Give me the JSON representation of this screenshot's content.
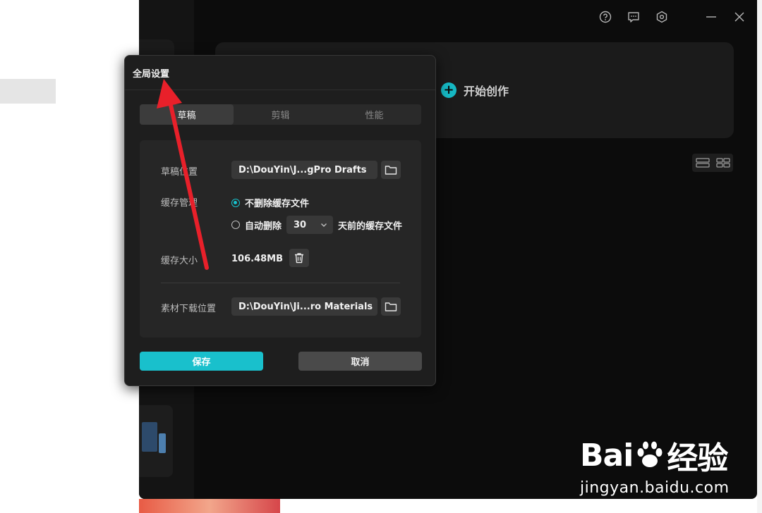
{
  "background_app": {
    "create_label": "开始创作",
    "titlebar_icons": [
      "help-icon",
      "feedback-icon",
      "settings-icon",
      "minimize-icon",
      "close-icon"
    ]
  },
  "dialog": {
    "title": "全局设置",
    "tabs": [
      {
        "label": "草稿",
        "active": true
      },
      {
        "label": "剪辑",
        "active": false
      },
      {
        "label": "性能",
        "active": false
      }
    ],
    "draft_location": {
      "label": "草稿位置",
      "value": "D:\\DouYin\\J...gPro Drafts"
    },
    "cache_management": {
      "label": "缓存管理",
      "option_keep": "不删除缓存文件",
      "option_auto_prefix": "自动删除",
      "days_value": "30",
      "option_auto_suffix": "天前的缓存文件",
      "selected": "keep"
    },
    "cache_size": {
      "label": "缓存大小",
      "value": "106.48MB"
    },
    "material_location": {
      "label": "素材下载位置",
      "value": "D:\\DouYin\\Ji...ro Materials"
    },
    "save_label": "保存",
    "cancel_label": "取消"
  },
  "watermark": {
    "logo_text_1": "Bai",
    "logo_text_2": "经验",
    "url": "jingyan.baidu.com"
  },
  "colors": {
    "accent": "#19c0cc",
    "arrow": "#e8202a"
  }
}
